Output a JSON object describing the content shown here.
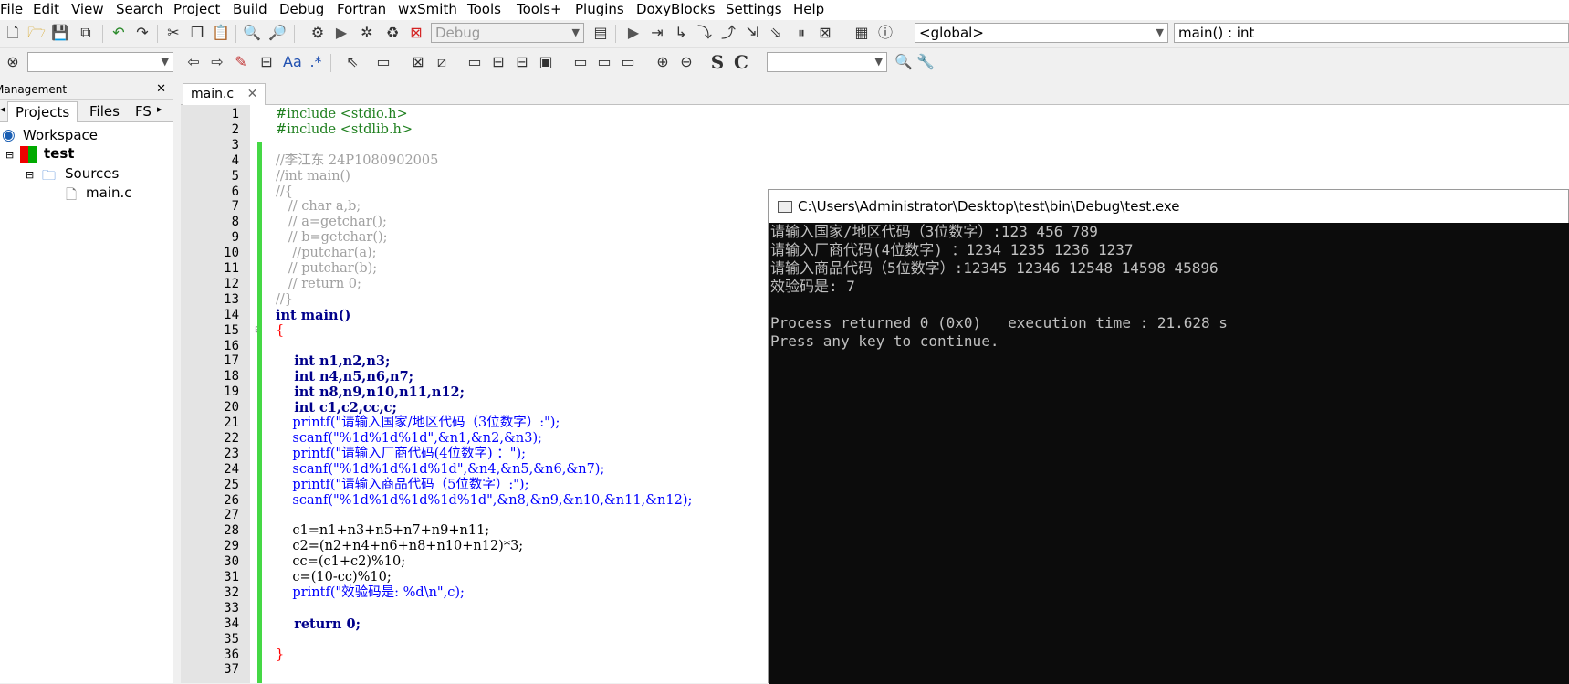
{
  "menu": [
    "File",
    "Edit",
    "View",
    "Search",
    "Project",
    "Build",
    "Debug",
    "Fortran",
    "wxSmith",
    "Tools",
    "Tools+",
    "Plugins",
    "DoxyBlocks",
    "Settings",
    "Help"
  ],
  "toolbar": {
    "build_target": "Debug",
    "scope": "<global>",
    "symbol": "main() : int",
    "search_regex": ".*"
  },
  "management": {
    "title": "Management",
    "tabs": [
      "Projects",
      "Files",
      "FS"
    ],
    "tree": {
      "workspace": "Workspace",
      "project": "test",
      "folder": "Sources",
      "file": "main.c"
    }
  },
  "editor": {
    "tab": "main.c",
    "line_numbers": [
      "1",
      "2",
      "3",
      "4",
      "5",
      "6",
      "7",
      "8",
      "9",
      "10",
      "11",
      "12",
      "13",
      "14",
      "15",
      "16",
      "17",
      "18",
      "19",
      "20",
      "21",
      "22",
      "23",
      "24",
      "25",
      "26",
      "27",
      "28",
      "29",
      "30",
      "31",
      "32",
      "33",
      "34",
      "35",
      "36",
      "37"
    ],
    "lines": [
      "#include <stdio.h>",
      "#include <stdlib.h>",
      "",
      "//李江东 24P1080902005",
      "//int main()",
      "//{",
      "   // char a,b;",
      "   // a=getchar();",
      "   // b=getchar();",
      "    //putchar(a);",
      "   // putchar(b);",
      "   // return 0;",
      "//}",
      "int main()",
      "{",
      "",
      "    int n1,n2,n3;",
      "    int n4,n5,n6,n7;",
      "    int n8,n9,n10,n11,n12;",
      "    int c1,c2,cc,c;",
      "    printf(\"请输入国家/地区代码（3位数字）:\");",
      "    scanf(\"%1d%1d%1d\",&n1,&n2,&n3);",
      "    printf(\"请输入厂商代码(4位数字) ：\");",
      "    scanf(\"%1d%1d%1d%1d\",&n4,&n5,&n6,&n7);",
      "    printf(\"请输入商品代码（5位数字）:\");",
      "    scanf(\"%1d%1d%1d%1d%1d\",&n8,&n9,&n10,&n11,&n12);",
      "",
      "    c1=n1+n3+n5+n7+n9+n11;",
      "    c2=(n2+n4+n6+n8+n10+n12)*3;",
      "    cc=(c1+c2)%10;",
      "    c=(10-cc)%10;",
      "    printf(\"效验码是: %d\\n\",c);",
      "",
      "    return 0;",
      "",
      "}",
      ""
    ]
  },
  "console": {
    "title": "C:\\Users\\Administrator\\Desktop\\test\\bin\\Debug\\test.exe",
    "lines": [
      "请输入国家/地区代码（3位数字）:123 456 789",
      "请输入厂商代码(4位数字) ：1234 1235 1236 1237",
      "请输入商品代码（5位数字）:12345 12346 12548 14598 45896",
      "效验码是: 7",
      "",
      "Process returned 0 (0x0)   execution time : 21.628 s",
      "Press any key to continue."
    ]
  }
}
